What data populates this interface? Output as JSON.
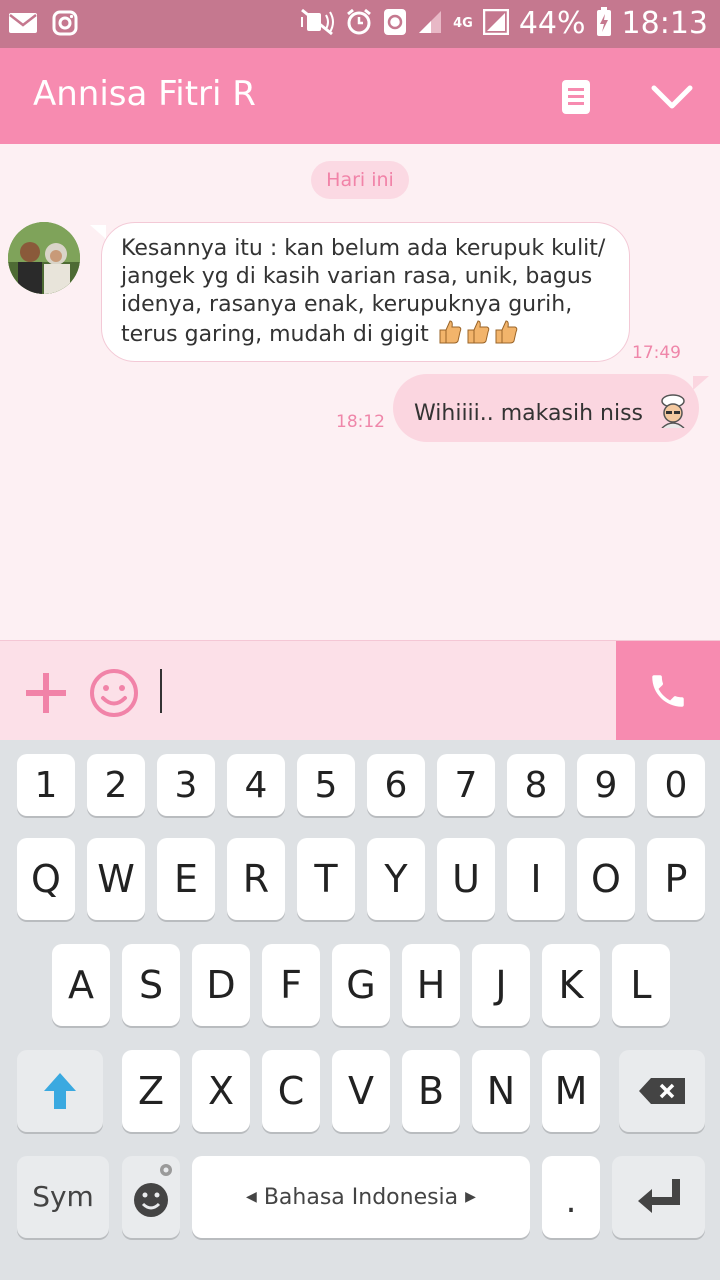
{
  "status_bar": {
    "battery": "44%",
    "time": "18:13",
    "network": "4G",
    "icons": [
      "mail-icon",
      "instagram-icon",
      "mute-icon",
      "alarm-icon",
      "sync-icon",
      "signal-icon",
      "battery-icon"
    ]
  },
  "app_bar": {
    "title": "Annisa Fitri R",
    "icons": [
      "notes-icon",
      "chevron-down-icon"
    ]
  },
  "chat": {
    "date_label": "Hari ini",
    "messages": [
      {
        "direction": "incoming",
        "lines": [
          "Kesannya itu : kan belum ada kerupuk kulit/",
          "jangek yg di kasih varian rasa,  unik,  bagus",
          "idenya,  rasanya enak,  kerupuknya gurih,",
          "terus garing, mudah di gigit"
        ],
        "emoji": [
          "thumbs-up-icon",
          "thumbs-up-icon",
          "thumbs-up-icon"
        ],
        "time": "17:49"
      },
      {
        "direction": "outgoing",
        "text": "Wihiiii.. makasih niss",
        "emoji": [
          "chef-sticker-icon"
        ],
        "time": "18:12"
      }
    ]
  },
  "input_bar": {
    "value": "",
    "icons": [
      "plus-icon",
      "smiley-icon",
      "phone-icon"
    ]
  },
  "keyboard": {
    "number_row": [
      "1",
      "2",
      "3",
      "4",
      "5",
      "6",
      "7",
      "8",
      "9",
      "0"
    ],
    "row1": [
      "Q",
      "W",
      "E",
      "R",
      "T",
      "Y",
      "U",
      "I",
      "O",
      "P"
    ],
    "row2": [
      "A",
      "S",
      "D",
      "F",
      "G",
      "H",
      "J",
      "K",
      "L"
    ],
    "row3": [
      "Z",
      "X",
      "C",
      "V",
      "B",
      "N",
      "M"
    ],
    "sym_label": "Sym",
    "space_label": "Bahasa Indonesia",
    "period_label": "."
  },
  "colors": {
    "accent": "#f78bb0",
    "status_bar": "#c5788f",
    "chat_bg": "#fdf0f3",
    "outgoing_bubble": "#fbd6e0"
  }
}
